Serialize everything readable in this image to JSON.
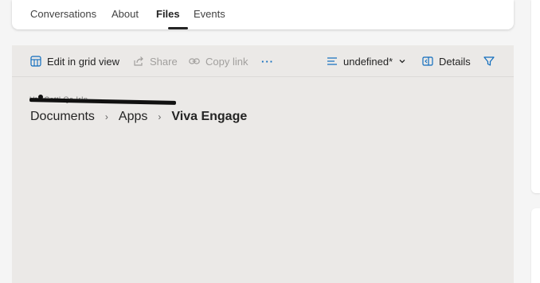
{
  "tabs": [
    {
      "label": "Conversations"
    },
    {
      "label": "About"
    },
    {
      "label": "Files"
    },
    {
      "label": "Events"
    }
  ],
  "active_tab": "Files",
  "toolbar": {
    "edit_grid": "Edit in grid view",
    "share": "Share",
    "copy_link": "Copy link",
    "more": "···",
    "view_selector": "undefined*",
    "details": "Details"
  },
  "redacted_text": "Ut l Cattl Qa IrIn",
  "breadcrumb": [
    "Documents",
    "Apps",
    "Viva Engage"
  ],
  "breadcrumb_separator": "›",
  "colors": {
    "accent": "#0f6cbd",
    "panel_background": "#ebe9e7",
    "page_background": "#f5f5f5"
  }
}
